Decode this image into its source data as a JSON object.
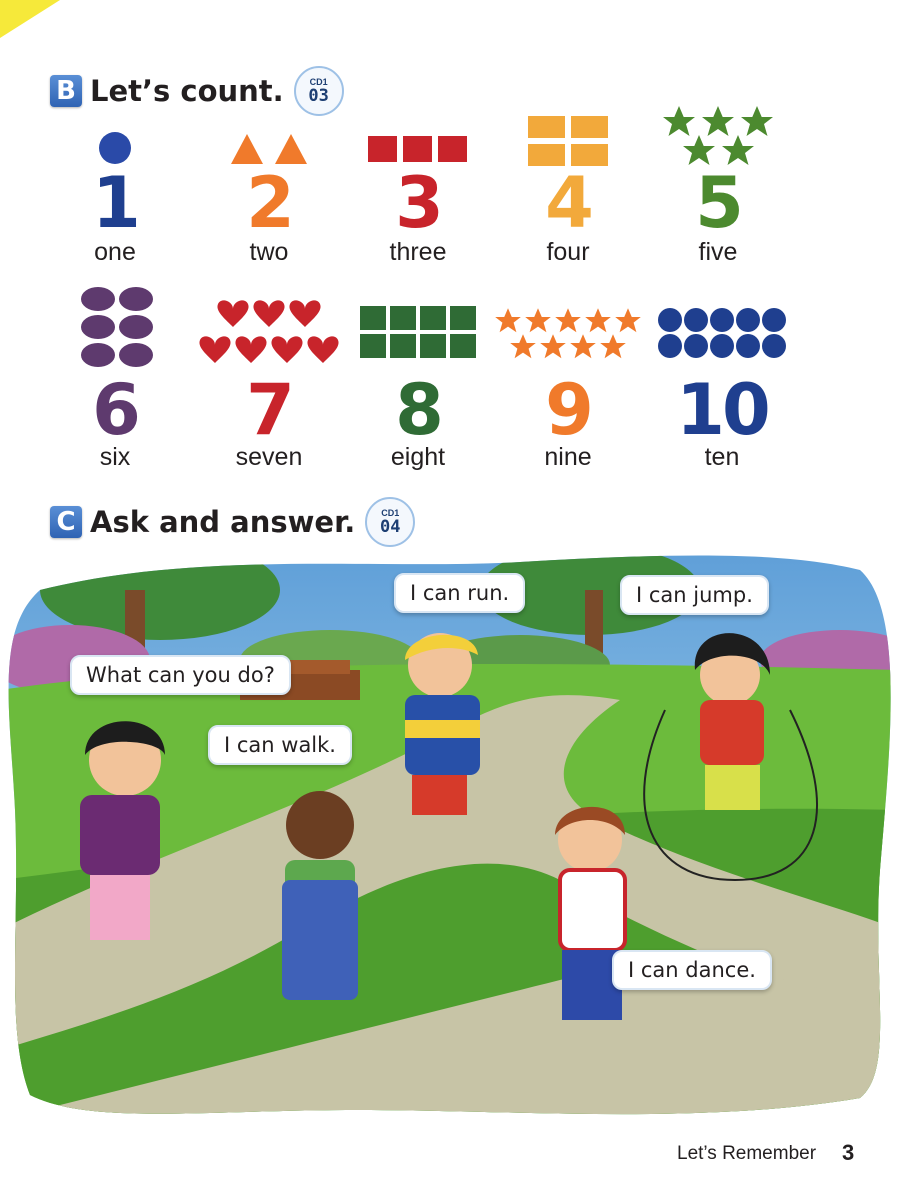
{
  "section_b": {
    "letter": "B",
    "title": "Let’s count.",
    "cd_label": "CD1",
    "track": "03"
  },
  "section_c": {
    "letter": "C",
    "title": "Ask and answer.",
    "cd_label": "CD1",
    "track": "04"
  },
  "numbers": [
    {
      "digit": "1",
      "word": "one",
      "color": "#1f3f8f",
      "shape": "circle",
      "shape_color": "#2a4aa8"
    },
    {
      "digit": "2",
      "word": "two",
      "color": "#f07a2b",
      "shape": "triangle",
      "shape_color": "#f07a2b"
    },
    {
      "digit": "3",
      "word": "three",
      "color": "#c8242b",
      "shape": "square",
      "shape_color": "#c8242b"
    },
    {
      "digit": "4",
      "word": "four",
      "color": "#f2a93b",
      "shape": "rectangle",
      "shape_color": "#f2a93b"
    },
    {
      "digit": "5",
      "word": "five",
      "color": "#4c8a2f",
      "shape": "star",
      "shape_color": "#4c8a2f"
    },
    {
      "digit": "6",
      "word": "six",
      "color": "#5e3a6e",
      "shape": "oval",
      "shape_color": "#5e3a6e"
    },
    {
      "digit": "7",
      "word": "seven",
      "color": "#c8242b",
      "shape": "heart",
      "shape_color": "#c8242b"
    },
    {
      "digit": "8",
      "word": "eight",
      "color": "#2f6b35",
      "shape": "square",
      "shape_color": "#2f6b35"
    },
    {
      "digit": "9",
      "word": "nine",
      "color": "#f07a2b",
      "shape": "star",
      "shape_color": "#f07a2b"
    },
    {
      "digit": "10",
      "word": "ten",
      "color": "#1f3f8f",
      "shape": "circle",
      "shape_color": "#1f3f8f"
    }
  ],
  "bubbles": {
    "run": "I can run.",
    "jump": "I can jump.",
    "what": "What can you do?",
    "walk": "I can walk.",
    "dance": "I can dance."
  },
  "footer": {
    "text": "Let’s Remember",
    "page": "3"
  }
}
